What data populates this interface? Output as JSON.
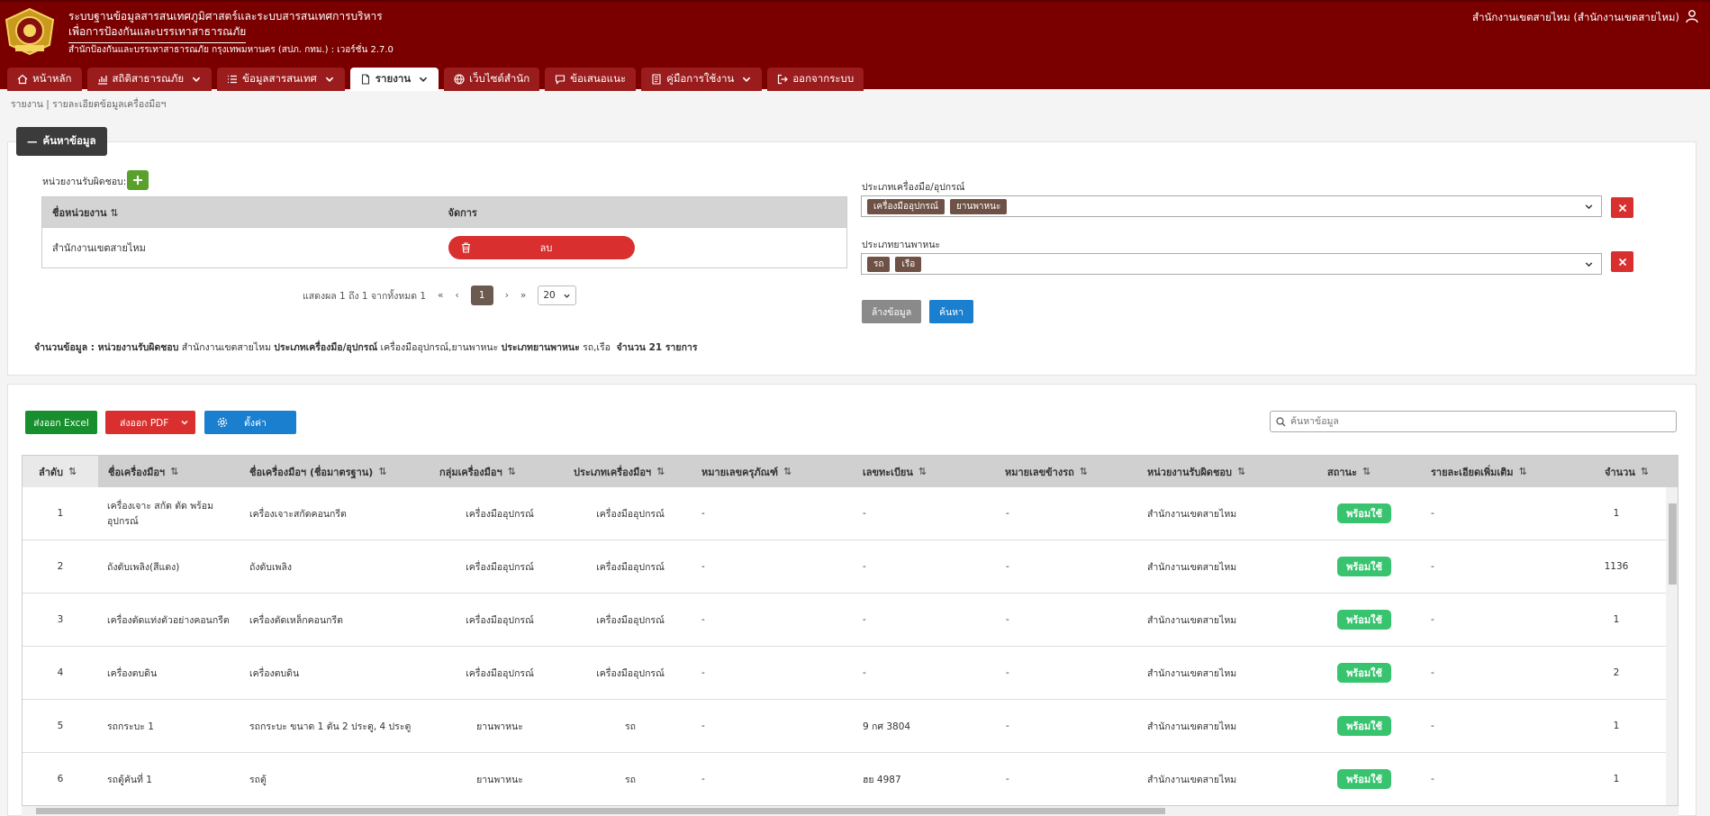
{
  "header": {
    "title_line1": "ระบบฐานข้อมูลสารสนเทศภูมิศาสตร์และระบบสารสนเทศการบริหาร",
    "title_line2": "เพื่อการป้องกันและบรรเทาสาธารณภัย",
    "subtitle": "สำนักป้องกันและบรรเทาสาธารณภัย กรุงเทพมหานคร (สปภ. กทม.) : เวอร์ชั่น 2.7.0",
    "user": "สำนักงานเขตสายไหม (สำนักงานเขตสายไหม)"
  },
  "nav": [
    {
      "label": "หน้าหลัก",
      "icon": "home-icon",
      "dropdown": false,
      "active": false
    },
    {
      "label": "สถิติสาธารณภัย",
      "icon": "chart-icon",
      "dropdown": true,
      "active": false
    },
    {
      "label": "ข้อมูลสารสนเทศ",
      "icon": "list-icon",
      "dropdown": true,
      "active": false
    },
    {
      "label": "รายงาน",
      "icon": "file-icon",
      "dropdown": true,
      "active": true
    },
    {
      "label": "เว็บไซต์สำนัก",
      "icon": "globe-icon",
      "dropdown": false,
      "active": false
    },
    {
      "label": "ข้อเสนอแนะ",
      "icon": "comment-icon",
      "dropdown": false,
      "active": false
    },
    {
      "label": "คู่มือการใช้งาน",
      "icon": "book-icon",
      "dropdown": true,
      "active": false
    },
    {
      "label": "ออกจากระบบ",
      "icon": "logout-icon",
      "dropdown": false,
      "active": false
    }
  ],
  "breadcrumb": "รายงาน | รายละเอียดข้อมูลเครื่องมือฯ",
  "search_panel": {
    "toggle_label": "ค้นหาข้อมูล",
    "resp_label": "หน่วยงานรับผิดชอบ:",
    "unit_table": {
      "headers": [
        "ชื่อหน่วยงาน",
        "จัดการ"
      ],
      "rows": [
        {
          "name": "สำนักงานเขตสายไหม",
          "action": "ลบ"
        }
      ]
    },
    "pager": {
      "info": "แสดงผล 1 ถึง 1 จากทั้งหมด 1",
      "first": "«",
      "prev": "‹",
      "current": "1",
      "next": "›",
      "last": "»",
      "page_size": "20"
    },
    "filter1": {
      "label": "ประเภทเครื่องมือ/อุปกรณ์",
      "chips": [
        "เครื่องมืออุปกรณ์",
        "ยานพาหนะ"
      ]
    },
    "filter2": {
      "label": "ประเภทยานพาหนะ",
      "chips": [
        "รถ",
        "เรือ"
      ]
    },
    "clear_label": "ล้างข้อมูล",
    "search_label": "ค้นหา",
    "summary": {
      "k1": "จำนวนข้อมูล : ",
      "k2": "หน่วยงานรับผิดชอบ",
      "v2": "สำนักงานเขตสายไหม",
      "k3": "ประเภทเครื่องมือ/อุปกรณ์",
      "v3": "เครื่องมืออุปกรณ์,ยานพาหนะ",
      "k4": "ประเภทยานพาหนะ",
      "v4": "รถ,เรือ",
      "k5": "จำนวน 21 รายการ"
    }
  },
  "toolbar": {
    "excel_label": "ส่งออก Excel",
    "pdf_label": "ส่งออก PDF",
    "settings_label": "ตั้งค่า",
    "search_placeholder": "ค้นหาข้อมูล"
  },
  "columns": [
    "ลำดับ",
    "ชื่อเครื่องมือฯ",
    "ชื่อเครื่องมือฯ (ชื่อมาตรฐาน)",
    "กลุ่มเครื่องมือฯ",
    "ประเภทเครื่องมือฯ",
    "หมายเลขครุภัณฑ์",
    "เลขทะเบียน",
    "หมายเลขข้างรถ",
    "หน่วยงานรับผิดชอบ",
    "สถานะ",
    "รายละเอียดเพิ่มเติม",
    "จำนวน"
  ],
  "rows": [
    {
      "no": "1",
      "name": "เครื่องเจาะ สกัด ตัด พร้อม อุปกรณ์",
      "std": "เครื่องเจาะสกัดคอนกรีต",
      "group": "เครื่องมืออุปกรณ์",
      "type": "เครื่องมืออุปกรณ์",
      "asset": "-",
      "plate": "-",
      "side": "-",
      "unit": "สำนักงานเขตสายไหม",
      "status": "พร้อมใช้",
      "detail": "-",
      "qty": "1"
    },
    {
      "no": "2",
      "name": "ถังดับเพลิง(สีแดง)",
      "std": "ถังดับเพลิง",
      "group": "เครื่องมืออุปกรณ์",
      "type": "เครื่องมืออุปกรณ์",
      "asset": "-",
      "plate": "-",
      "side": "-",
      "unit": "สำนักงานเขตสายไหม",
      "status": "พร้อมใช้",
      "detail": "-",
      "qty": "1136"
    },
    {
      "no": "3",
      "name": "เครื่องตัดแท่งตัวอย่างคอนกรีต",
      "std": "เครื่องตัดเหล็กคอนกรีต",
      "group": "เครื่องมืออุปกรณ์",
      "type": "เครื่องมืออุปกรณ์",
      "asset": "-",
      "plate": "-",
      "side": "-",
      "unit": "สำนักงานเขตสายไหม",
      "status": "พร้อมใช้",
      "detail": "-",
      "qty": "1"
    },
    {
      "no": "4",
      "name": "เครื่องตบดิน",
      "std": "เครื่องตบดิน",
      "group": "เครื่องมืออุปกรณ์",
      "type": "เครื่องมืออุปกรณ์",
      "asset": "-",
      "plate": "-",
      "side": "-",
      "unit": "สำนักงานเขตสายไหม",
      "status": "พร้อมใช้",
      "detail": "-",
      "qty": "2"
    },
    {
      "no": "5",
      "name": "รถกระบะ 1",
      "std": "รถกระบะ ขนาด 1 ตัน 2 ประตู, 4 ประตู",
      "group": "ยานพาหนะ",
      "type": "รถ",
      "asset": "-",
      "plate": "9 กศ 3804",
      "side": "-",
      "unit": "สำนักงานเขตสายไหม",
      "status": "พร้อมใช้",
      "detail": "-",
      "qty": "1"
    },
    {
      "no": "6",
      "name": "รถตู้คันที่ 1",
      "std": "รถตู้",
      "group": "ยานพาหนะ",
      "type": "รถ",
      "asset": "-",
      "plate": "ฮย 4987",
      "side": "-",
      "unit": "สำนักงานเขตสายไหม",
      "status": "พร้อมใช้",
      "detail": "-",
      "qty": "1"
    }
  ],
  "colors": {
    "header_bg": "#7a0000",
    "status_green": "#38c46f",
    "delete_red": "#d9302f",
    "primary_blue": "#1a7fce",
    "excel_green": "#178f2e"
  }
}
